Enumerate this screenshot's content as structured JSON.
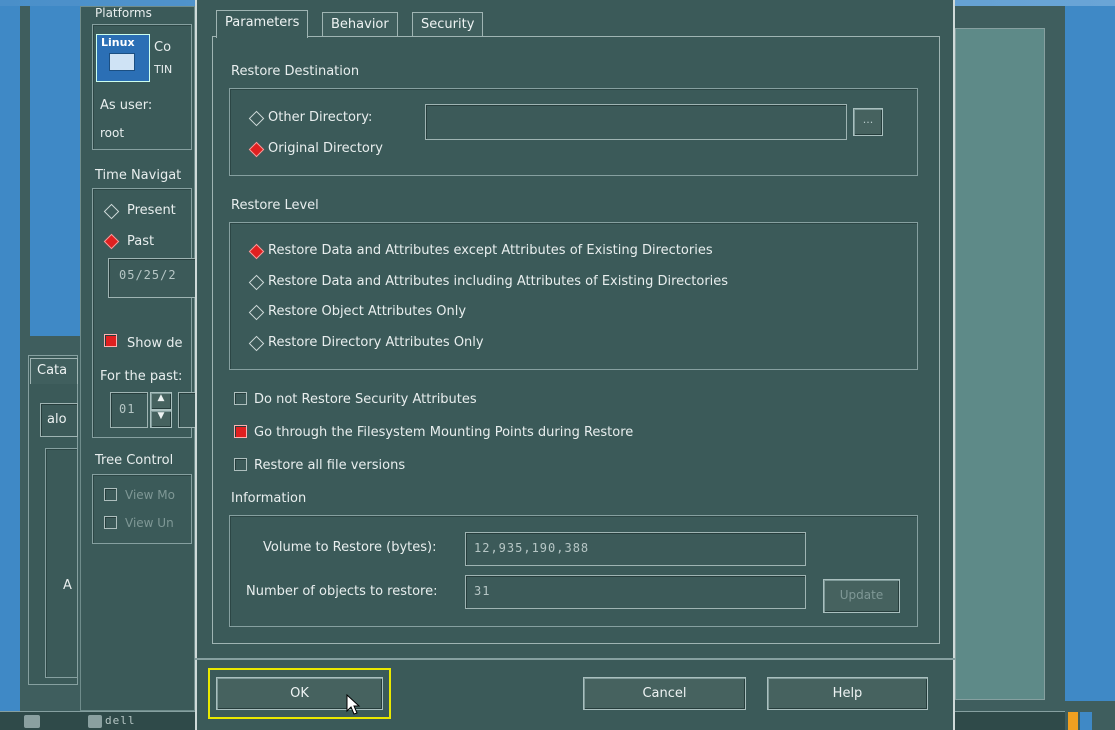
{
  "left_panel": {
    "platforms_label": "Platforms",
    "platform_name_fragment": "Co",
    "platform_sub_fragment": "TIN",
    "linux_logo_text": "Linux",
    "as_user_label": "As user:",
    "user_value": "root",
    "time_navigation_label": "Time Navigat",
    "present_label": "Present",
    "past_label": "Past",
    "date_value": "05/25/2",
    "show_label": "Show de",
    "catalog_tab_label": "Cata",
    "for_the_past_label": "For the past:",
    "count_value": "01",
    "tree_control_label": "Tree Control",
    "view_mo_label": "View Mo",
    "view_un_label": "View Un",
    "catalog_field_value": "alo",
    "side_char": "A",
    "bottom_item_label": "dell"
  },
  "dialog": {
    "tabs": [
      {
        "label": "Parameters",
        "active": true
      },
      {
        "label": "Behavior",
        "active": false
      },
      {
        "label": "Security",
        "active": false
      }
    ],
    "restore_destination": {
      "title": "Restore Destination",
      "other_directory_label": "Other Directory:",
      "other_directory_value": "",
      "browse_label": "...",
      "original_directory_label": "Original Directory",
      "selected": "original"
    },
    "restore_level": {
      "title": "Restore Level",
      "options": [
        {
          "label": "Restore Data and Attributes except Attributes of Existing Directories",
          "selected": true
        },
        {
          "label": "Restore Data and Attributes including Attributes of Existing Directories",
          "selected": false
        },
        {
          "label": "Restore Object Attributes Only",
          "selected": false
        },
        {
          "label": "Restore Directory Attributes Only",
          "selected": false
        }
      ]
    },
    "options": [
      {
        "label": "Do not Restore Security Attributes",
        "checked": false
      },
      {
        "label": "Go through the Filesystem Mounting Points during Restore",
        "checked": true
      },
      {
        "label": "Restore all file versions",
        "checked": false
      }
    ],
    "information": {
      "title": "Information",
      "volume_label": "Volume to Restore (bytes):",
      "volume_value": "12,935,190,388",
      "objects_label": "Number of objects to restore:",
      "objects_value": "31",
      "update_label": "Update"
    },
    "buttons": {
      "ok": "OK",
      "cancel": "Cancel",
      "help": "Help"
    }
  },
  "colors": {
    "background": "#3f5e5e",
    "accent_blue": "#3f89c6",
    "selected_red": "#e02020",
    "focus_yellow": "#e8e800"
  }
}
